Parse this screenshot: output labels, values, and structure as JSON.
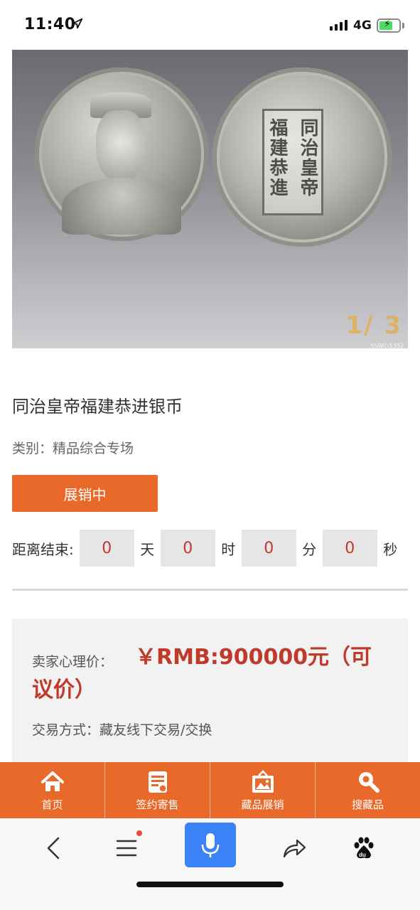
{
  "status_bar": {
    "time": "11:40",
    "network": "4G",
    "battery_level": 0.7,
    "location_icon": "location-arrow-icon"
  },
  "product": {
    "title": "同治皇帝福建恭进银币",
    "category": "类别：精品综合专场",
    "status_label": "展销中",
    "photo_counter": "1/ 3",
    "photo_code": "SSWC-1352",
    "coin_inscription": [
      "同治皇帝",
      "福建恭進"
    ]
  },
  "countdown": {
    "label": "距离结束:",
    "days": "0",
    "days_unit": "天",
    "hours": "0",
    "hours_unit": "时",
    "minutes": "0",
    "minutes_unit": "分",
    "seconds": "0",
    "seconds_unit": "秒"
  },
  "pricing": {
    "label": "卖家心理价：",
    "value": "￥RMB:900000元（可议价）",
    "trade_method": "交易方式：藏友线下交易/交换"
  },
  "tabbar": {
    "items": [
      {
        "label": "首页",
        "icon": "home-icon"
      },
      {
        "label": "签约寄售",
        "icon": "contract-icon"
      },
      {
        "label": "藏品展销",
        "icon": "gallery-icon"
      },
      {
        "label": "搜藏品",
        "icon": "search-icon"
      }
    ]
  },
  "browser": {
    "icons": [
      "back-icon",
      "menu-icon",
      "microphone-icon",
      "share-icon",
      "baidu-icon"
    ],
    "colors": {
      "accent": "#e8692a",
      "mic": "#3b82f6",
      "price": "#c0392b"
    }
  }
}
